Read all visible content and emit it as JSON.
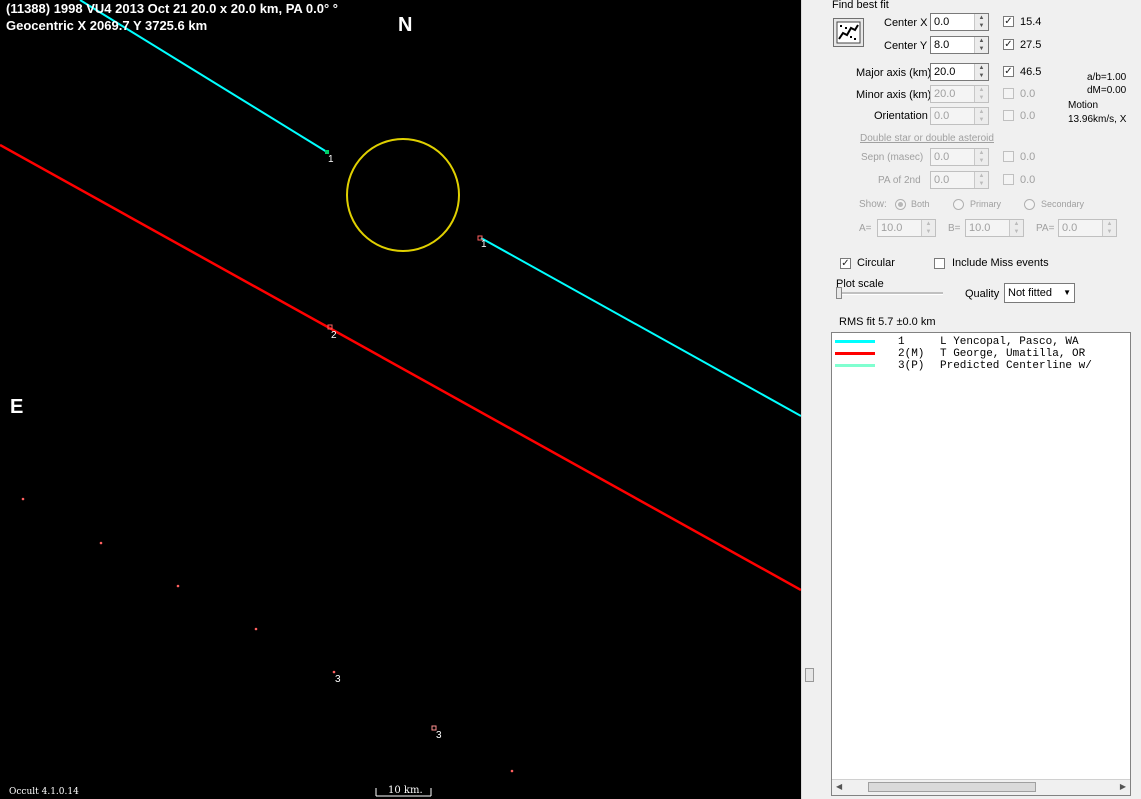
{
  "plot": {
    "header_line1": "(11388) 1998 VU4  2013 Oct 21   20.0 x 20.0 km, PA 0.0° °",
    "header_line2": "Geocentric  X  2069.7  Y 3725.6 km",
    "north_label": "N",
    "east_label": "E",
    "version": "Occult 4.1.0.14",
    "scale_label": "10 km.",
    "chord_labels": [
      "1",
      "1",
      "2",
      "3",
      "3"
    ],
    "colors": {
      "background": "#000000",
      "chord1": "#00ffff",
      "chord2": "#ff0000",
      "ellipse": "#e0d000",
      "dots": "#ff6060"
    }
  },
  "panel": {
    "find_best_fit": "Find best fit",
    "rows": [
      {
        "label": "Center X",
        "value": "0.0",
        "checked": true,
        "fit": "15.4"
      },
      {
        "label": "Center Y",
        "value": "8.0",
        "checked": true,
        "fit": "27.5"
      },
      {
        "label": "Major axis (km)",
        "value": "20.0",
        "checked": true,
        "fit": "46.5"
      },
      {
        "label": "Minor axis (km)",
        "value": "20.0",
        "checked": false,
        "fit": "0.0"
      },
      {
        "label": "Orientation",
        "value": "0.0",
        "checked": false,
        "fit": "0.0"
      }
    ],
    "ab_ratio": "a/b=1.00",
    "dm": "dM=0.00",
    "motion_label": "Motion",
    "motion_value": "13.96km/s, X",
    "double_star_label": "Double star  or  double asteroid",
    "sepn": {
      "label": "Sepn (masec)",
      "value": "0.0",
      "fit": "0.0"
    },
    "pa2": {
      "label": "PA of 2nd",
      "value": "0.0",
      "fit": "0.0"
    },
    "show_label": "Show:",
    "show_options": [
      "Both",
      "Primary",
      "Secondary"
    ],
    "a_label": "A=",
    "a_value": "10.0",
    "b_label": "B=",
    "b_value": "10.0",
    "pa_label": "PA=",
    "pa_value": "0.0",
    "circular_label": "Circular",
    "circular_checked": true,
    "miss_label": "Include Miss events",
    "miss_checked": false,
    "plot_scale_label": "Plot scale",
    "quality_label": "Quality",
    "quality_value": "Not fitted",
    "rms_fit": "RMS fit 5.7 ±0.0 km",
    "observers": [
      {
        "num": "1",
        "name": "L Yencopal, Pasco, WA",
        "color": "#00ffff"
      },
      {
        "num": "2(M)",
        "name": "T George, Umatilla, OR",
        "color": "#ff0000"
      },
      {
        "num": "3(P)",
        "name": "Predicted Centerline w/",
        "color": "#80ffd0"
      }
    ]
  }
}
